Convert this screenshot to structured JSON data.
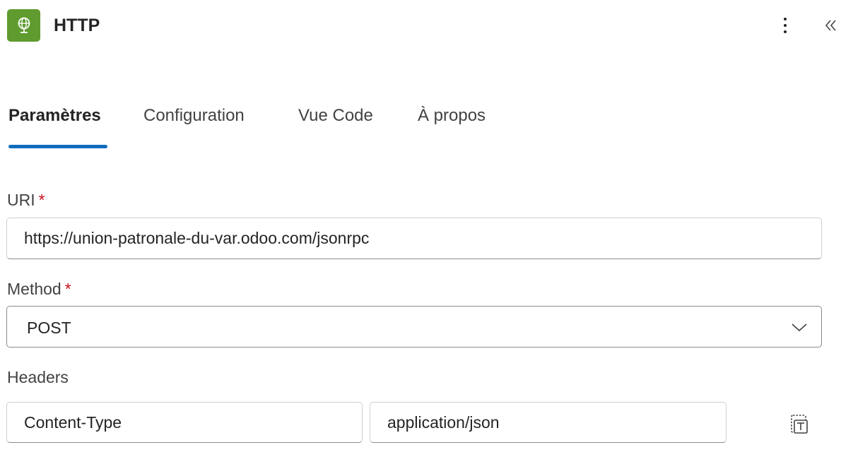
{
  "header": {
    "title": "HTTP",
    "icon": "globe-icon",
    "icon_color": "#5f9b2e"
  },
  "tabs": [
    {
      "label": "Paramètres",
      "active": true
    },
    {
      "label": "Configuration",
      "active": false
    },
    {
      "label": "Vue Code",
      "active": false
    },
    {
      "label": "À propos",
      "active": false
    }
  ],
  "accent_color": "#0f6cbd",
  "form": {
    "uri": {
      "label": "URI",
      "required_marker": "*",
      "value": "https://union-patronale-du-var.odoo.com/jsonrpc"
    },
    "method": {
      "label": "Method",
      "required_marker": "*",
      "value": "POST"
    },
    "headers": {
      "label": "Headers",
      "rows": [
        {
          "key": "Content-Type",
          "value": "application/json"
        }
      ]
    }
  }
}
